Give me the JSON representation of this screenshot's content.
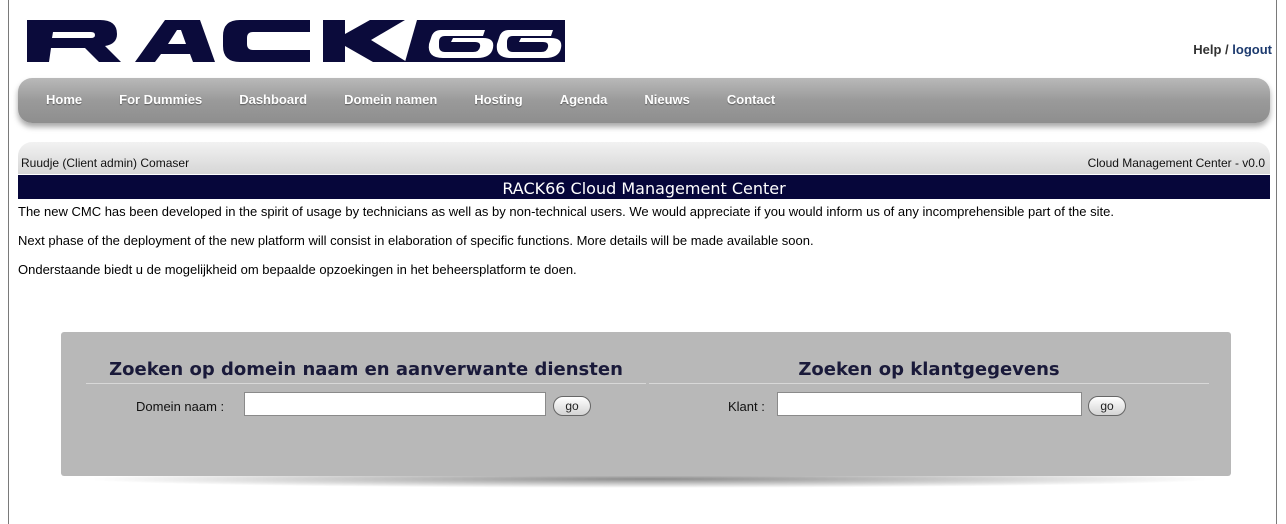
{
  "header": {
    "logo_text": "RACK66",
    "help_label": "Help",
    "separator": " / ",
    "logout_label": "logout"
  },
  "nav": {
    "items": [
      "Home",
      "For Dummies",
      "Dashboard",
      "Domein namen",
      "Hosting",
      "Agenda",
      "Nieuws",
      "Contact"
    ]
  },
  "infobar": {
    "user": "Ruudje (Client admin) Comaser",
    "version": "Cloud Management Center - v0.0"
  },
  "title": "RACK66 Cloud Management Center",
  "paragraphs": [
    "The new CMC has been developed in the spirit of usage by technicians as well as by non-technical users. We would appreciate if you would inform us of any incomprehensible part of the site.",
    "Next phase of the deployment of the new platform will consist in elaboration of specific functions. More details will be made available soon.",
    "Onderstaande biedt u de mogelijkheid om bepaalde opzoekingen in het beheersplatform te doen."
  ],
  "search": {
    "domain": {
      "heading": "Zoeken op domein naam en aanverwante diensten",
      "label": "Domein naam :",
      "value": "",
      "button": "go"
    },
    "client": {
      "heading": "Zoeken op klantgegevens",
      "label": "Klant :",
      "value": "",
      "button": "go"
    }
  },
  "colors": {
    "title_bg": "#06063a",
    "nav_bg": "#9a9a9a",
    "panel_bg": "#b8b8b8",
    "logout_link": "#1c3a6e"
  }
}
